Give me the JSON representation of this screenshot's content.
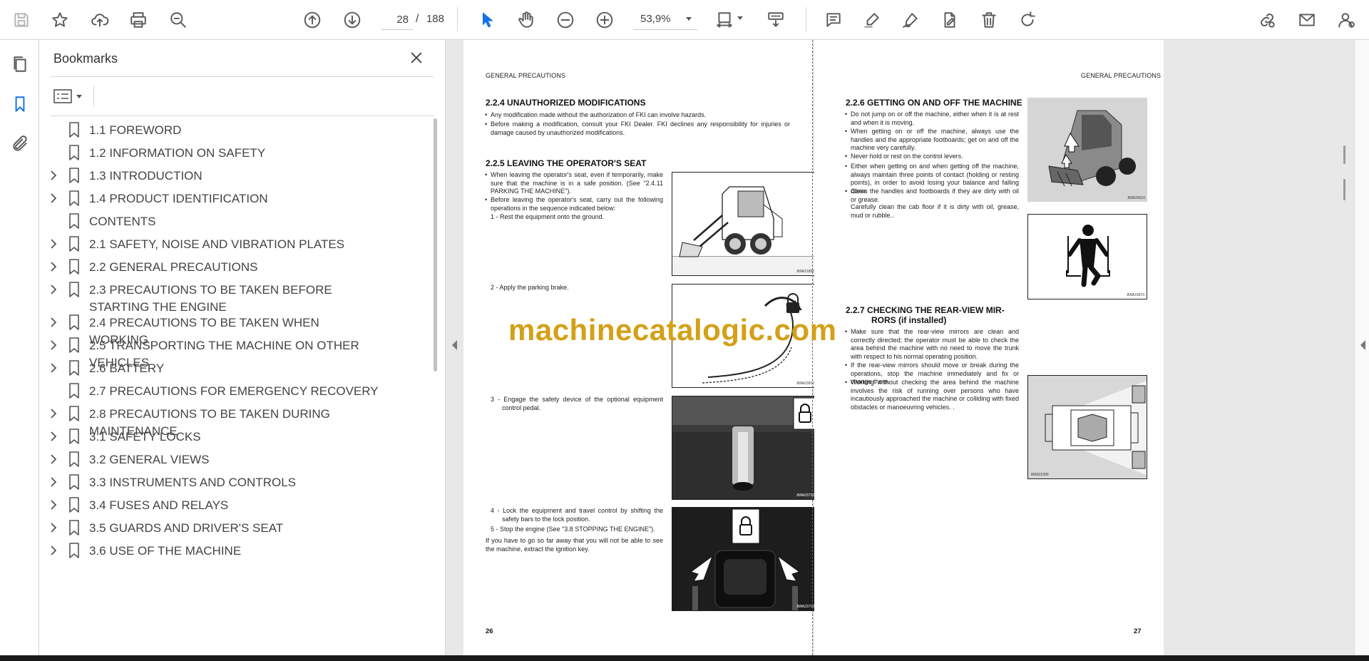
{
  "toolbar": {
    "current_page": "28",
    "page_separator": "/",
    "total_pages": "188",
    "zoom": "53,9%"
  },
  "bookmarks": {
    "title": "Bookmarks",
    "items": [
      {
        "label": "1.1 FOREWORD",
        "expandable": false
      },
      {
        "label": "1.2 INFORMATION ON SAFETY",
        "expandable": false
      },
      {
        "label": "1.3 INTRODUCTION",
        "expandable": true
      },
      {
        "label": "1.4 PRODUCT IDENTIFICATION",
        "expandable": true
      },
      {
        "label": "CONTENTS",
        "expandable": false
      },
      {
        "label": "2.1 SAFETY, NOISE AND VIBRATION PLATES",
        "expandable": true
      },
      {
        "label": "2.2 GENERAL PRECAUTIONS",
        "expandable": true
      },
      {
        "label": "2.3 PRECAUTIONS TO BE TAKEN BEFORE STARTING THE ENGINE",
        "expandable": true
      },
      {
        "label": "2.4 PRECAUTIONS TO BE TAKEN WHEN WORKING",
        "expandable": true
      },
      {
        "label": "2.5 TRANSPORTING THE MACHINE ON OTHER VEHICLES",
        "expandable": true
      },
      {
        "label": "2.6 BATTERY",
        "expandable": true
      },
      {
        "label": "2.7 PRECAUTIONS FOR EMERGENCY RECOVERY",
        "expandable": false
      },
      {
        "label": "2.8 PRECAUTIONS TO BE TAKEN DURING MAINTENANCE",
        "expandable": true
      },
      {
        "label": "3.1 SAFETY LOCKS",
        "expandable": true
      },
      {
        "label": "3.2 GENERAL VIEWS",
        "expandable": true
      },
      {
        "label": "3.3 INSTRUMENTS AND CONTROLS",
        "expandable": true
      },
      {
        "label": "3.4 FUSES AND RELAYS",
        "expandable": true
      },
      {
        "label": "3.5 GUARDS AND DRIVER'S SEAT",
        "expandable": true
      },
      {
        "label": "3.6 USE OF THE MACHINE",
        "expandable": true
      }
    ]
  },
  "page_left": {
    "header": "GENERAL PRECAUTIONS",
    "s224_title": "2.2.4   UNAUTHORIZED MODIFICATIONS",
    "s224_b1": "Any modification made without the authorization of FKI can involve hazards.",
    "s224_b2": "Before making a modification, consult your FKI Dealer. FKI declines any responsibility for injuries or damage caused by unauthorized modifications.",
    "s225_title": "2.2.5   LEAVING THE OPERATOR'S SEAT",
    "s225_b1": "When leaving the operator's seat, even if temporarily, make sure that the machine is in a safe position. (See \"2.4.11 PARKING THE MACHINE\").",
    "s225_b2": "Before leaving the operator's seat, carry out the following operations in the sequence indicated below:",
    "step1": "1 -  Rest the equipment onto the ground.",
    "step2": "2 -  Apply the parking brake.",
    "step3": "3 -  Engage the safety device of the optional equipment control pedal.",
    "step4": "4 -  Lock the equipment and travel control by shifting the safety bars to the lock position.",
    "step5": "5 -  Stop the engine (See \"3.8 STOPPING THE ENGINE\").",
    "note": "If you have to go so far away that you will not be able to see the machine, extract the ignition key.",
    "fig1_code": "8WA21890",
    "fig2_code": "8WA23910",
    "fig3_code": "8WA23730",
    "fig4_code": "8WA23710",
    "page_number": "26"
  },
  "page_right": {
    "header": "GENERAL PRECAUTIONS",
    "s226_title": "2.2.6   GETTING ON AND OFF THE MACHINE",
    "s226_b1": "Do not jump on or off the machine, either when it is at rest and when it is moving.",
    "s226_b2": "When getting on or off the machine, always use the handles and the appropriate footboards; get on and off the machine very carefully.",
    "s226_b3": "Never hold or rest on the control levers.",
    "s226_b4": "Either when getting on and when getting off the machine, always maintain three points of contact (holding or resting points), in order to avoid losing your balance and falling down.",
    "s226_b5": "Clean the handles and footboards if they are dirty with oil or grease.",
    "s226_b5b": "Carefully clean the cab floor if it is dirty with oil, grease, mud or rubble..",
    "s227_title_1": "2.2.7   CHECKING THE REAR-VIEW MIR-",
    "s227_title_2": "RORS (if installed)",
    "s227_b1": "Make sure that the rear-view mirrors are clean and correctly directed; the operator must be able to check the area behind the machine with no need to move the trunk with respect to his normal operating position.",
    "s227_b2": "If the rear-view mirrors should move or break during the operations, stop the machine immediately and fix or change them.",
    "s227_b3": "Working without checking the area behind the machine involves the risk of running over persons who have incautiously approached the machine or colliding with fixed obstacles or manoeuvring vehicles. .",
    "fig5_code": "8WA24510",
    "fig6_code": "8WA15670",
    "fig7_code": "8WA21900",
    "page_number": "27"
  },
  "watermark": "machinecatalogic.com"
}
